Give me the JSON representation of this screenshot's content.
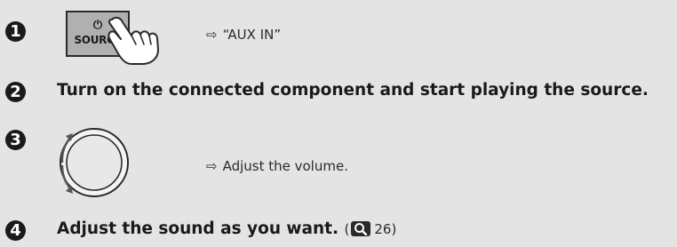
{
  "steps": [
    {
      "number": "1",
      "result_arrow": "⇨",
      "result_text": "“AUX IN”"
    },
    {
      "number": "2",
      "text": "Turn on the connected component and start playing the source."
    },
    {
      "number": "3",
      "result_arrow": "⇨",
      "result_text": "Adjust the volume."
    },
    {
      "number": "4",
      "text": "Adjust the sound as you want.",
      "reference_open": "(",
      "reference_page": "26",
      "reference_close": ")",
      "reference_icon": "magnifier-icon"
    }
  ],
  "source_button": {
    "power_symbol": "⏻",
    "label": "SOURCE"
  },
  "colors": {
    "background": "#e4e4e4",
    "button_face": "#b0b0b0",
    "step_badge": "#1a1a1a",
    "text": "#1a1a1a"
  }
}
